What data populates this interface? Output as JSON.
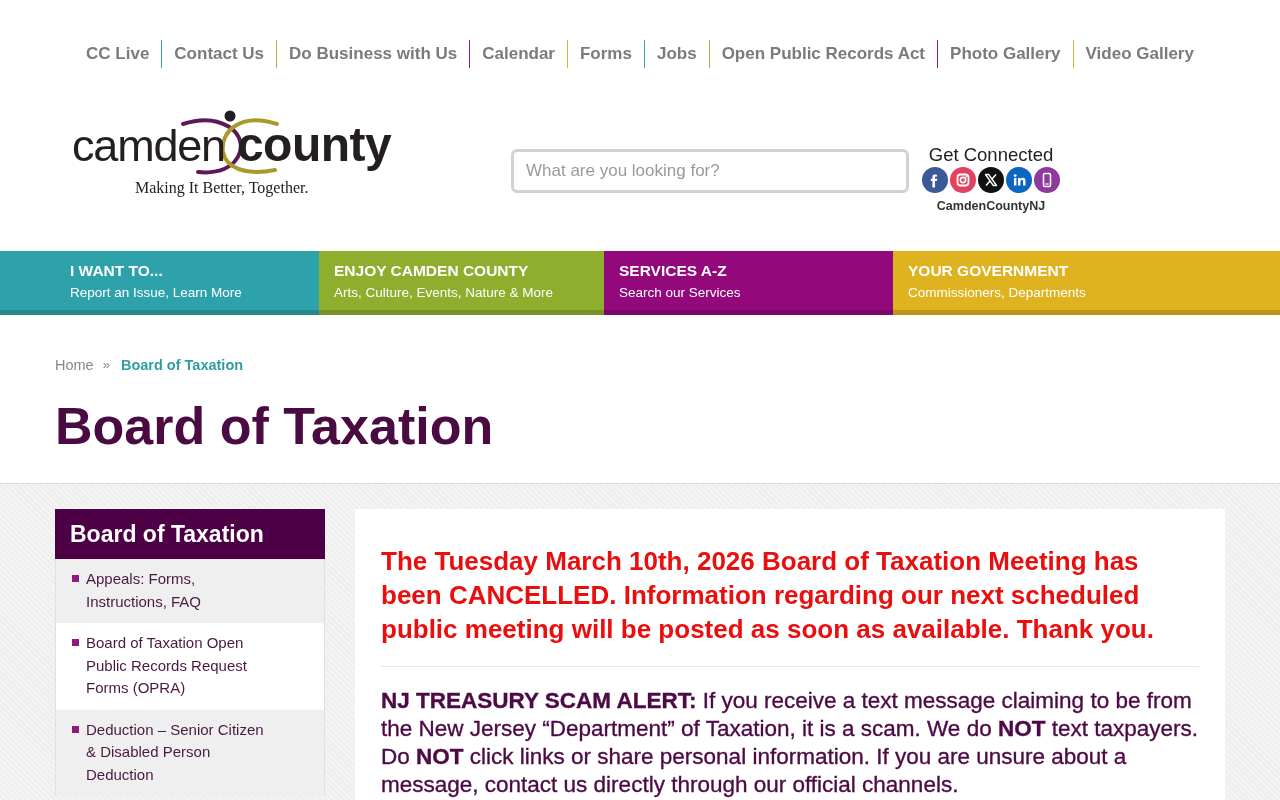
{
  "top_nav": [
    "CC Live",
    "Contact Us",
    "Do Business with Us",
    "Calendar",
    "Forms",
    "Jobs",
    "Open Public Records Act",
    "Photo Gallery",
    "Video Gallery"
  ],
  "header": {
    "logo": {
      "word_1": "camden",
      "word_2": "county",
      "tagline": "Making It Better, Together."
    },
    "search": {
      "placeholder": "What are you looking for?"
    },
    "social": {
      "title": "Get Connected",
      "links": [
        {
          "kind": "facebook",
          "color": "#3b5998"
        },
        {
          "kind": "instagram",
          "color": "#e4405f"
        },
        {
          "kind": "x",
          "color": "#111111"
        },
        {
          "kind": "linkedin",
          "color": "#0a66c2"
        },
        {
          "kind": "phone",
          "color": "#8e3a9d"
        }
      ],
      "handle": "CamdenCountyNJ"
    }
  },
  "main_nav": [
    {
      "title": "I WANT TO...",
      "subtitle": "Report an Issue, Learn More",
      "color": "#2ea2ab"
    },
    {
      "title": "ENJOY CAMDEN COUNTY",
      "subtitle": "Arts, Culture, Events, Nature & More",
      "color": "#8fae2e"
    },
    {
      "title": "SERVICES A-Z",
      "subtitle": "Search our Services",
      "color": "#93097c"
    },
    {
      "title": "YOUR GOVERNMENT",
      "subtitle": "Commissioners, Departments",
      "color": "#dfb220"
    }
  ],
  "breadcrumb": {
    "items": [
      {
        "label": "Home",
        "selected": false
      },
      {
        "label": "Board of Taxation",
        "selected": true
      }
    ],
    "separator": "»"
  },
  "page_title": "Board of Taxation",
  "sidebar": {
    "title": "Board of Taxation",
    "items": [
      {
        "label": "Appeals: Forms, Instructions, FAQ"
      },
      {
        "label": "Board of Taxation Open Public Records Request Forms (OPRA)"
      },
      {
        "label": "Deduction – Senior Citizen & Disabled Person Deduction"
      }
    ]
  },
  "content": {
    "notice": "The Tuesday March 10th, 2026 Board of Taxation Meeting has been CANCELLED. Information regarding our next scheduled public meeting will be posted as soon as available. Thank you.",
    "alert": "**NJ TREASURY SCAM ALERT:** If you receive a text message claiming to be from the New Jersey “Department” of Taxation, it is a scam. We do **NOT** text taxpayers. Do **NOT** click links or share personal information. If you are unsure about a message, contact us directly through our official channels."
  }
}
